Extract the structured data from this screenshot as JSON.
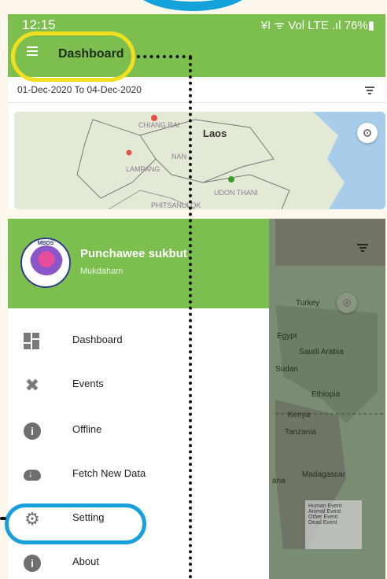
{
  "status_bar": {
    "time": "12:15",
    "indicators": "¥I ᯤ Vol LTE .ıl 76%▮"
  },
  "app_bar": {
    "title": "Dashboard"
  },
  "date_range": "01-Dec-2020 To 04-Dec-2020",
  "map_top": {
    "labels": [
      "CHIANG RAI",
      "NAN",
      "LAMPANG",
      "UDON THANI",
      "PHITSANULOK"
    ],
    "country": "Laos"
  },
  "drawer": {
    "user_name": "Punchawee sukbut",
    "user_location": "Mukdaham",
    "logo_text": "MBDS",
    "items": [
      {
        "label": "Dashboard",
        "icon": "dashboard-icon"
      },
      {
        "label": "Events",
        "icon": "events-icon"
      },
      {
        "label": "Offline",
        "icon": "info-icon"
      },
      {
        "label": "Fetch New Data",
        "icon": "cloud-download-icon"
      },
      {
        "label": "Setting",
        "icon": "gear-icon"
      },
      {
        "label": "About",
        "icon": "info-icon"
      }
    ]
  },
  "map_bottom": {
    "labels": [
      "Turkey",
      "Egypt",
      "Saudi Arabia",
      "Sudan",
      "Ethiopia",
      "Kenya",
      "Tanzania",
      "Madagascar",
      "ana"
    ],
    "legend": [
      "Human Event",
      "Animal Event",
      "Other Event",
      "Dead Event"
    ]
  },
  "colors": {
    "primary_green": "#7cbf4f",
    "highlight_yellow": "#f0e020",
    "highlight_blue": "#18a0dc"
  }
}
